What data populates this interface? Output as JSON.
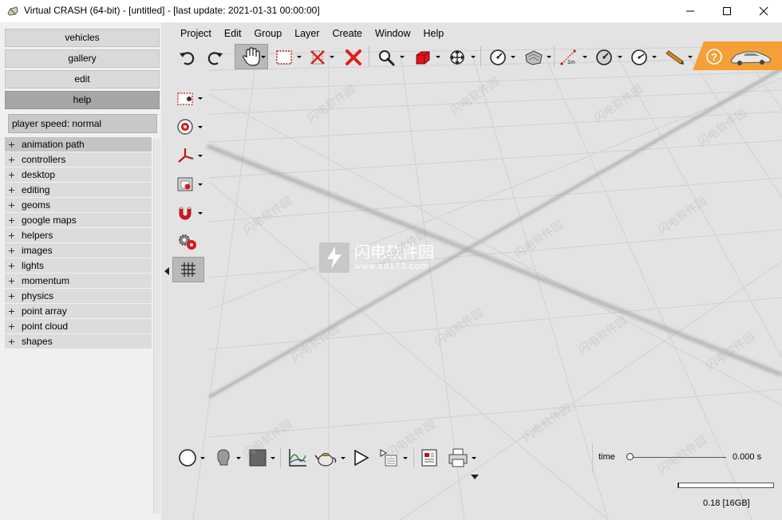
{
  "window": {
    "title": "Virtual CRASH (64-bit) - [untitled] -  [last update: 2021-01-31 00:00:00]",
    "controls": [
      "minimize-icon",
      "maximize-icon",
      "close-icon"
    ]
  },
  "nav": {
    "buttons": [
      {
        "label": "vehicles",
        "active": false
      },
      {
        "label": "gallery",
        "active": false
      },
      {
        "label": "edit",
        "active": false
      },
      {
        "label": "help",
        "active": true
      }
    ],
    "player_speed": "player speed: normal"
  },
  "tree": {
    "items": [
      "animation path",
      "controllers",
      "desktop",
      "editing",
      "geoms",
      "google maps",
      "helpers",
      "images",
      "lights",
      "momentum",
      "physics",
      "point array",
      "point cloud",
      "shapes"
    ]
  },
  "menu": {
    "items": [
      "Project",
      "Edit",
      "Group",
      "Layer",
      "Create",
      "Window",
      "Help"
    ]
  },
  "toolbar": {
    "icons": [
      "undo-icon",
      "redo-icon",
      "pan-hand-icon",
      "select-rectangle-icon",
      "no-select-icon",
      "delete-icon",
      "zoom-icon",
      "box-3d-icon",
      "move-icon",
      "gauge-icon",
      "terrain-icon",
      "measure-icon",
      "gauge2-icon",
      "gauge3-icon",
      "pencil-icon",
      "help-icon",
      "vehicle-icon"
    ],
    "measure_label": "1m"
  },
  "side_tools": {
    "icons": [
      "camera-icon",
      "target-icon",
      "axes-icon",
      "snapshot-icon",
      "magnet-icon",
      "gears-icon",
      "grid-icon"
    ]
  },
  "bottom_toolbar": {
    "icons": [
      "circle-icon",
      "head-icon",
      "square-icon",
      "graph-icon",
      "teapot-icon",
      "play-icon",
      "playlist-icon",
      "report-icon",
      "print-icon"
    ]
  },
  "timeline": {
    "label": "time",
    "value": "0.000 s",
    "position": 0
  },
  "memory": {
    "label": "0.18 [16GB]",
    "fill_fraction": 0.01
  },
  "watermark": {
    "title": "闪电软件园",
    "url": "www.sd173.com"
  },
  "colors": {
    "accent_orange": "#f5a037",
    "delete_red": "#e01e1e",
    "box_red": "#e0141e",
    "active_nav": "#a6a6a6"
  }
}
